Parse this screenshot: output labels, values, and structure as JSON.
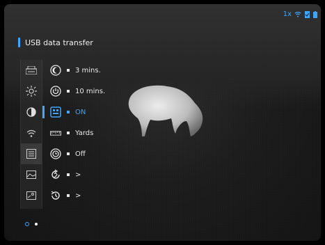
{
  "status": {
    "zoom": "1x",
    "accent_color": "#3ea6ff",
    "icons": [
      "wifi-icon",
      "sd-card-icon",
      "battery-icon"
    ]
  },
  "title": "USB data transfer",
  "left_icons": [
    "recording-settings-icon",
    "brightness-icon",
    "contrast-icon",
    "wifi-icon",
    "list-icon",
    "image-icon",
    "image-detail-icon"
  ],
  "left_active_index": 2,
  "menu": [
    {
      "icon": "moon-icon",
      "value": "3 mins."
    },
    {
      "icon": "power-icon",
      "value": "10 mins."
    },
    {
      "icon": "usb-mode-icon",
      "value": "ON",
      "active": true
    },
    {
      "icon": "ruler-icon",
      "value": "Yards"
    },
    {
      "icon": "clock-icon",
      "value": "Off"
    },
    {
      "icon": "reset-icon",
      "value": ">"
    },
    {
      "icon": "history-icon",
      "value": ">"
    }
  ],
  "pager": {
    "pages": 2,
    "current": 2
  }
}
